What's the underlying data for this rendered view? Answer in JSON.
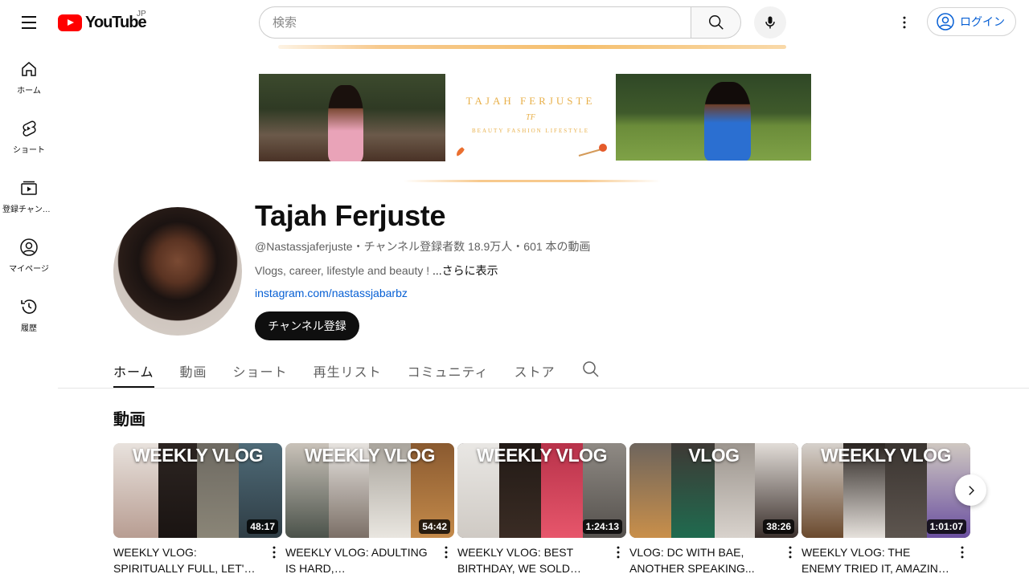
{
  "header": {
    "logo_text": "YouTube",
    "region": "JP",
    "search_placeholder": "検索",
    "login_label": "ログイン"
  },
  "sidebar": {
    "items": [
      {
        "label": "ホーム",
        "icon": "home-icon"
      },
      {
        "label": "ショート",
        "icon": "shorts-icon"
      },
      {
        "label": "登録チャンネル",
        "icon": "subscriptions-icon"
      },
      {
        "label": "マイページ",
        "icon": "you-icon"
      },
      {
        "label": "履歴",
        "icon": "history-icon"
      }
    ]
  },
  "banner": {
    "name": "TAJAH FERJUSTE",
    "initials": "TF",
    "tagline": "BEAUTY FASHION LIFESTYLE"
  },
  "channel": {
    "name": "Tajah Ferjuste",
    "meta": "@Nastassjaferjuste・チャンネル登録者数 18.9万人・601 本の動画",
    "description": "Vlogs, career, lifestyle and beauty !",
    "more_label": "...さらに表示",
    "link": "instagram.com/nastassjabarbz",
    "subscribe_label": "チャンネル登録"
  },
  "tabs": [
    "ホーム",
    "動画",
    "ショート",
    "再生リスト",
    "コミュニティ",
    "ストア"
  ],
  "active_tab": "ホーム",
  "section_title": "動画",
  "videos": [
    {
      "overlay": "WEEKLY VLOG",
      "duration": "48:17",
      "title": "WEEKLY VLOG: SPIRITUALLY FULL, LET'S ADDRESS IT, I..."
    },
    {
      "overlay": "WEEKLY VLOG",
      "duration": "54:42",
      "title": "WEEKLY VLOG: ADULTING IS HARD, ACCOUNTABILITY..."
    },
    {
      "overlay": "WEEKLY VLOG",
      "duration": "1:24:13",
      "title": "WEEKLY VLOG: BEST BIRTHDAY, WE SOLD OUT,..."
    },
    {
      "overlay": "VLOG",
      "duration": "38:26",
      "title": "VLOG: DC WITH BAE, ANOTHER SPEAKING..."
    },
    {
      "overlay": "WEEKLY VLOG",
      "duration": "1:01:07",
      "title": "WEEKLY VLOG: THE ENEMY TRIED IT, AMAZING NEWS,..."
    }
  ],
  "colors": {
    "brand_red": "#ff0000",
    "link_blue": "#065fd4",
    "banner_gold": "#e8b04a"
  }
}
